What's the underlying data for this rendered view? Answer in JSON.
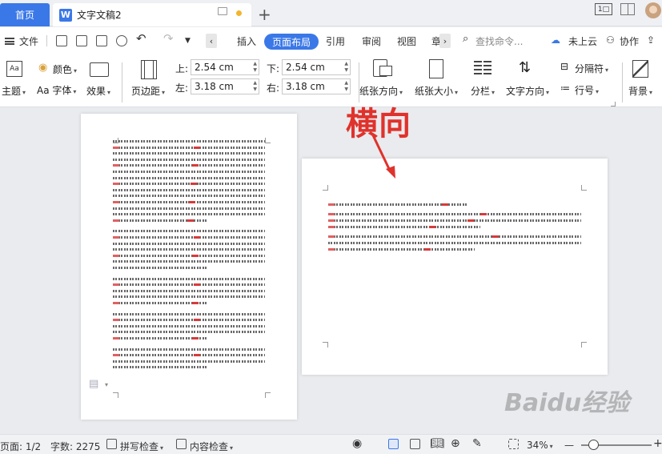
{
  "titlebar": {
    "home_tab": "首页",
    "doc_logo": "W",
    "doc_title": "文字文稿2",
    "new_tab": "+",
    "layout_icon_text": "1□"
  },
  "menu": {
    "file": "文件",
    "insert": "插入",
    "page_layout": "页面布局",
    "reference": "引用",
    "review": "审阅",
    "view": "视图",
    "more": "章",
    "search_placeholder": "查找命令...",
    "cloud": "未上云",
    "collab": "协作",
    "prev_arrow": "‹",
    "next_arrow": "›"
  },
  "ribbon": {
    "theme": "主题",
    "color": "颜色",
    "font": "Aa 字体",
    "effect": "效果",
    "margins": "页边距",
    "top_label": "上:",
    "top_value": "2.54 cm",
    "bottom_label": "下:",
    "bottom_value": "2.54 cm",
    "left_label": "左:",
    "left_value": "3.18 cm",
    "right_label": "右:",
    "right_value": "3.18 cm",
    "orientation": "纸张方向",
    "size": "纸张大小",
    "columns": "分栏",
    "text_direction": "文字方向",
    "separator": "分隔符",
    "line_numbers": "行号",
    "background": "背景"
  },
  "annotation": "横向",
  "watermark": "Baidu经验",
  "status": {
    "page": "页面: 1/2",
    "words": "字数: 2275",
    "spell": "拼写检查",
    "content_check": "内容检查",
    "zoom": "34%",
    "zoom_minus": "—",
    "zoom_plus": "+"
  },
  "colors": {
    "accent": "#3b78e7",
    "annotation": "#e0322c",
    "workspace": "#e9ebee"
  }
}
